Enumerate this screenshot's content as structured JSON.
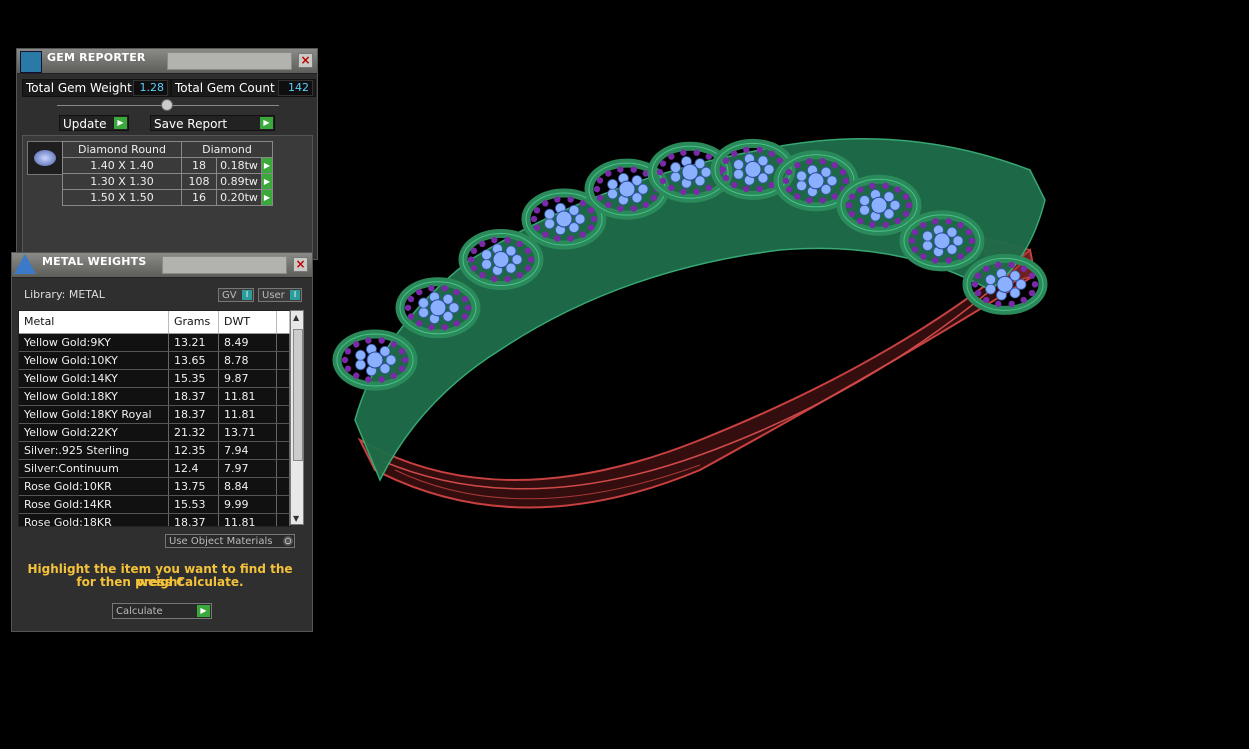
{
  "gem_reporter": {
    "title": "GEM REPORTER",
    "total_weight_label": "Total Gem Weight",
    "total_weight_value": "1.28",
    "total_count_label": "Total Gem Count",
    "total_count_value": "142",
    "update_label": "Update",
    "save_report_label": "Save Report",
    "table": {
      "headers": [
        "Diamond Round",
        "Diamond"
      ],
      "rows": [
        {
          "size": "1.40 X 1.40",
          "count": "18",
          "weight": "0.18tw"
        },
        {
          "size": "1.30 X 1.30",
          "count": "108",
          "weight": "0.89tw"
        },
        {
          "size": "1.50 X 1.50",
          "count": "16",
          "weight": "0.20tw"
        }
      ]
    }
  },
  "metal_weights": {
    "title": "METAL WEIGHTS",
    "library_label": "Library: METAL",
    "gv_label": "GV",
    "user_label": "User",
    "headers": [
      "Metal",
      "Grams",
      "DWT"
    ],
    "rows": [
      {
        "metal": "Yellow Gold:9KY",
        "grams": "13.21",
        "dwt": "8.49"
      },
      {
        "metal": "Yellow Gold:10KY",
        "grams": "13.65",
        "dwt": "8.78"
      },
      {
        "metal": "Yellow Gold:14KY",
        "grams": "15.35",
        "dwt": "9.87"
      },
      {
        "metal": "Yellow Gold:18KY",
        "grams": "18.37",
        "dwt": "11.81"
      },
      {
        "metal": "Yellow Gold:18KY Royal",
        "grams": "18.37",
        "dwt": "11.81"
      },
      {
        "metal": "Yellow Gold:22KY",
        "grams": "21.32",
        "dwt": "13.71"
      },
      {
        "metal": "Silver:.925 Sterling",
        "grams": "12.35",
        "dwt": "7.94"
      },
      {
        "metal": "Silver:Continuum",
        "grams": "12.4",
        "dwt": "7.97"
      },
      {
        "metal": "Rose Gold:10KR",
        "grams": "13.75",
        "dwt": "8.84"
      },
      {
        "metal": "Rose Gold:14KR",
        "grams": "15.53",
        "dwt": "9.99"
      },
      {
        "metal": "Rose Gold:18KR",
        "grams": "18.37",
        "dwt": "11.81"
      }
    ],
    "use_object_materials_label": "Use Object Materials",
    "hint_line1": "Highlight the item you want to find the weight",
    "hint_line2": "for then press Calculate.",
    "calculate_label": "Calculate"
  },
  "colors": {
    "band_green": "#1f6e4a",
    "band_red": "#b03030",
    "gem_blue": "#8ab0ff",
    "gem_purple": "#7a2aa8"
  }
}
